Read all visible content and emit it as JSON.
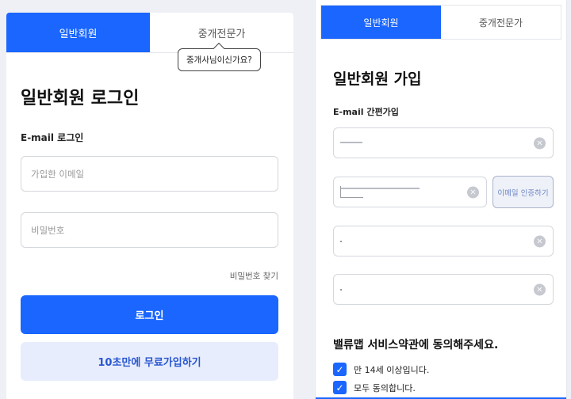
{
  "login": {
    "tabs": [
      "일반회원",
      "중개전문가"
    ],
    "tooltip": "중개사님이신가요?",
    "title": "일반회원 로그인",
    "subhead": "E-mail 로그인",
    "email_placeholder": "가입한 이메일",
    "password_placeholder": "비밀번호",
    "find_password": "비밀번호 찾기",
    "login_button": "로그인",
    "signup_button": "10초만에 무료가입하기"
  },
  "signup": {
    "tabs": [
      "일반회원",
      "중개전문가"
    ],
    "title": "일반회원 가입",
    "subhead": "E-mail 간편가입",
    "verify_button": "이메일 인증하기",
    "clear_icon": "×",
    "agree_title": "밸류맵 서비스약관에 동의해주세요.",
    "checks": [
      {
        "label": "만 14세 이상입니다.",
        "checked": true
      },
      {
        "label": "모두 동의합니다.",
        "checked": true
      }
    ],
    "accent_color": "#1a66ff"
  }
}
